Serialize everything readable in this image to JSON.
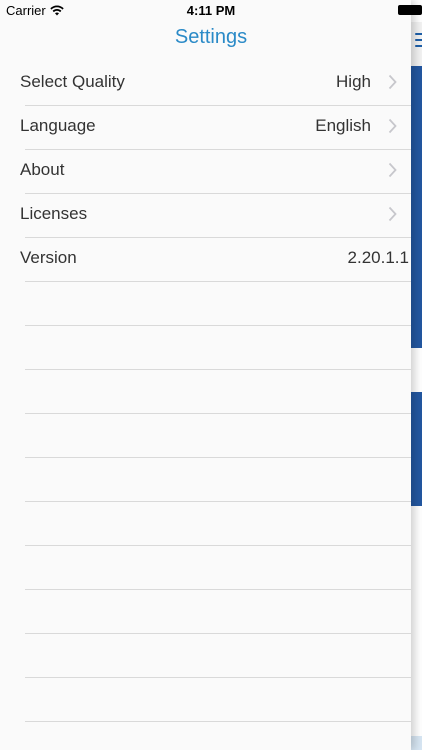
{
  "status_bar": {
    "carrier": "Carrier",
    "time": "4:11 PM",
    "icons": [
      "wifi-icon",
      "battery-icon"
    ]
  },
  "header": {
    "title": "Settings"
  },
  "settings": {
    "items": [
      {
        "label": "Select Quality",
        "value": "High",
        "chevron": true
      },
      {
        "label": "Language",
        "value": "English",
        "chevron": true
      },
      {
        "label": "About",
        "value": "",
        "chevron": true
      },
      {
        "label": "Licenses",
        "value": "",
        "chevron": true
      },
      {
        "label": "Version",
        "value": "2.20.1.1",
        "chevron": false
      }
    ]
  },
  "colors": {
    "accent": "#2a8ac7",
    "behind_blue": "#2357a0",
    "background": "#fafafa",
    "separator": "#d9d9d9"
  },
  "behind_app": {
    "menu_icon": "menu-icon"
  }
}
